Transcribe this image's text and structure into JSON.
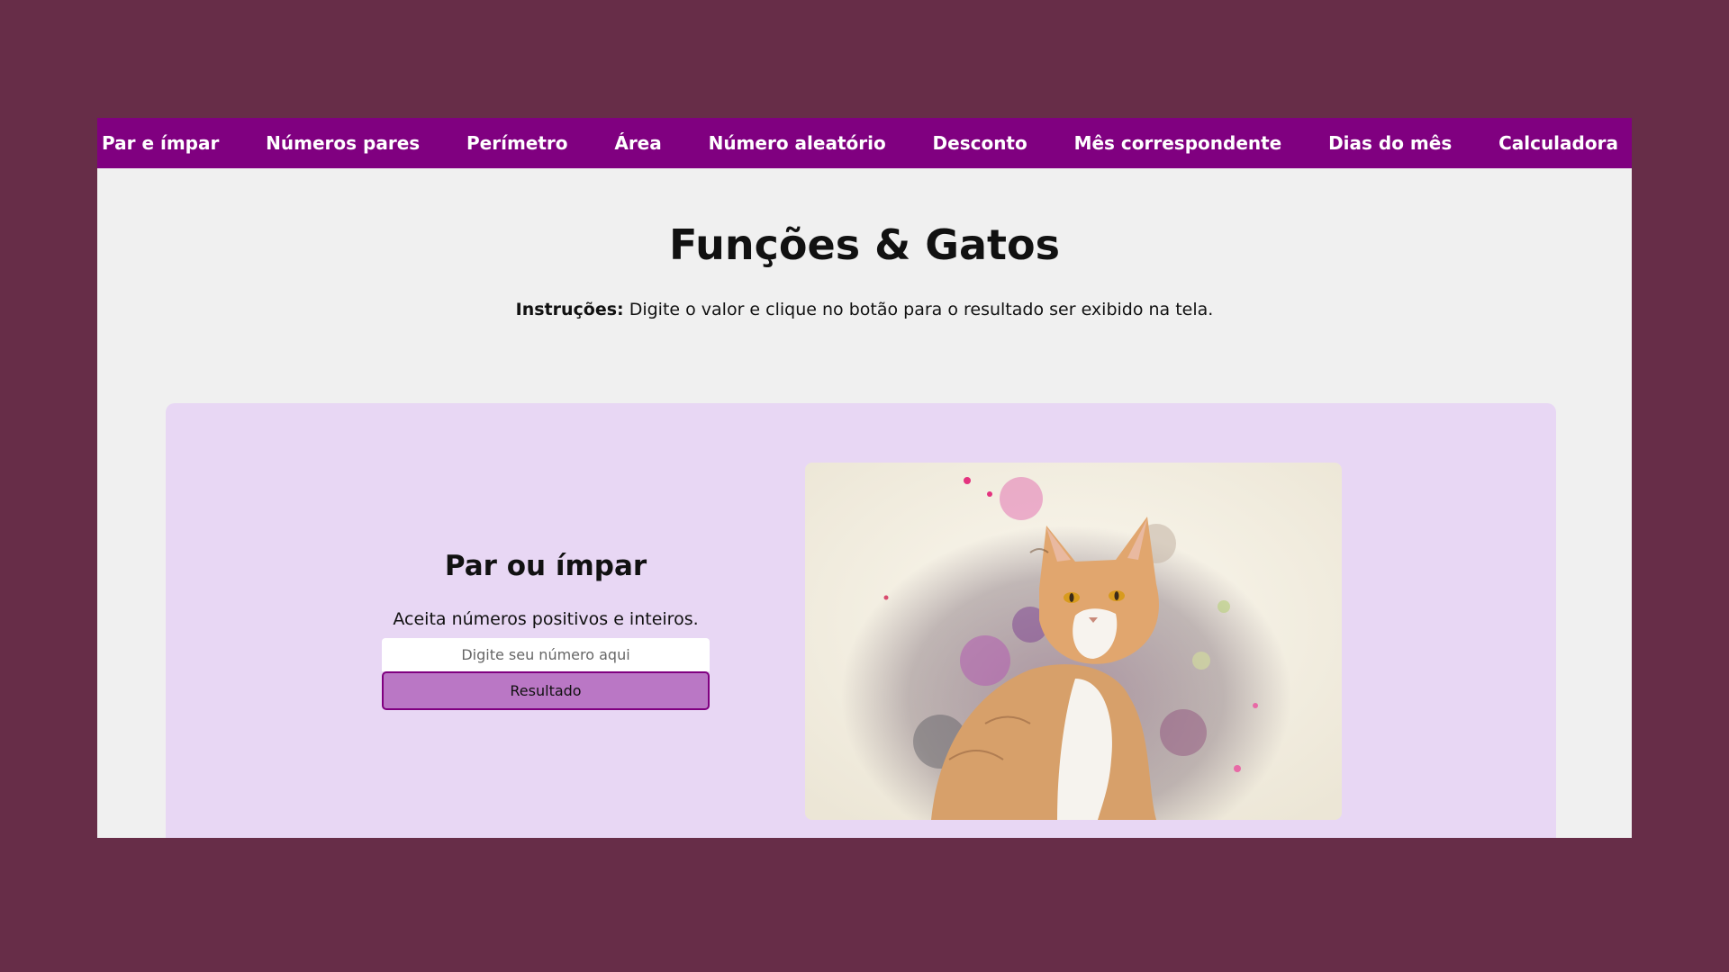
{
  "nav": {
    "items": [
      "Par e ímpar",
      "Números pares",
      "Perímetro",
      "Área",
      "Número aleatório",
      "Desconto",
      "Mês correspondente",
      "Dias do mês",
      "Calculadora"
    ]
  },
  "header": {
    "title": "Funções & Gatos",
    "instructions_label": "Instruções:",
    "instructions_text": " Digite o valor e clique no botão para o resultado ser exibido na tela."
  },
  "card": {
    "title": "Par ou ímpar",
    "description": "Aceita números positivos e inteiros.",
    "input_placeholder": "Digite seu número aqui",
    "input_value": "",
    "button_label": "Resultado"
  },
  "image": {
    "icon": "cat-watercolor-image"
  },
  "colors": {
    "background": "#672d48",
    "nav": "#800080",
    "panel": "#e8d7f4",
    "button": "#ba77c5"
  }
}
